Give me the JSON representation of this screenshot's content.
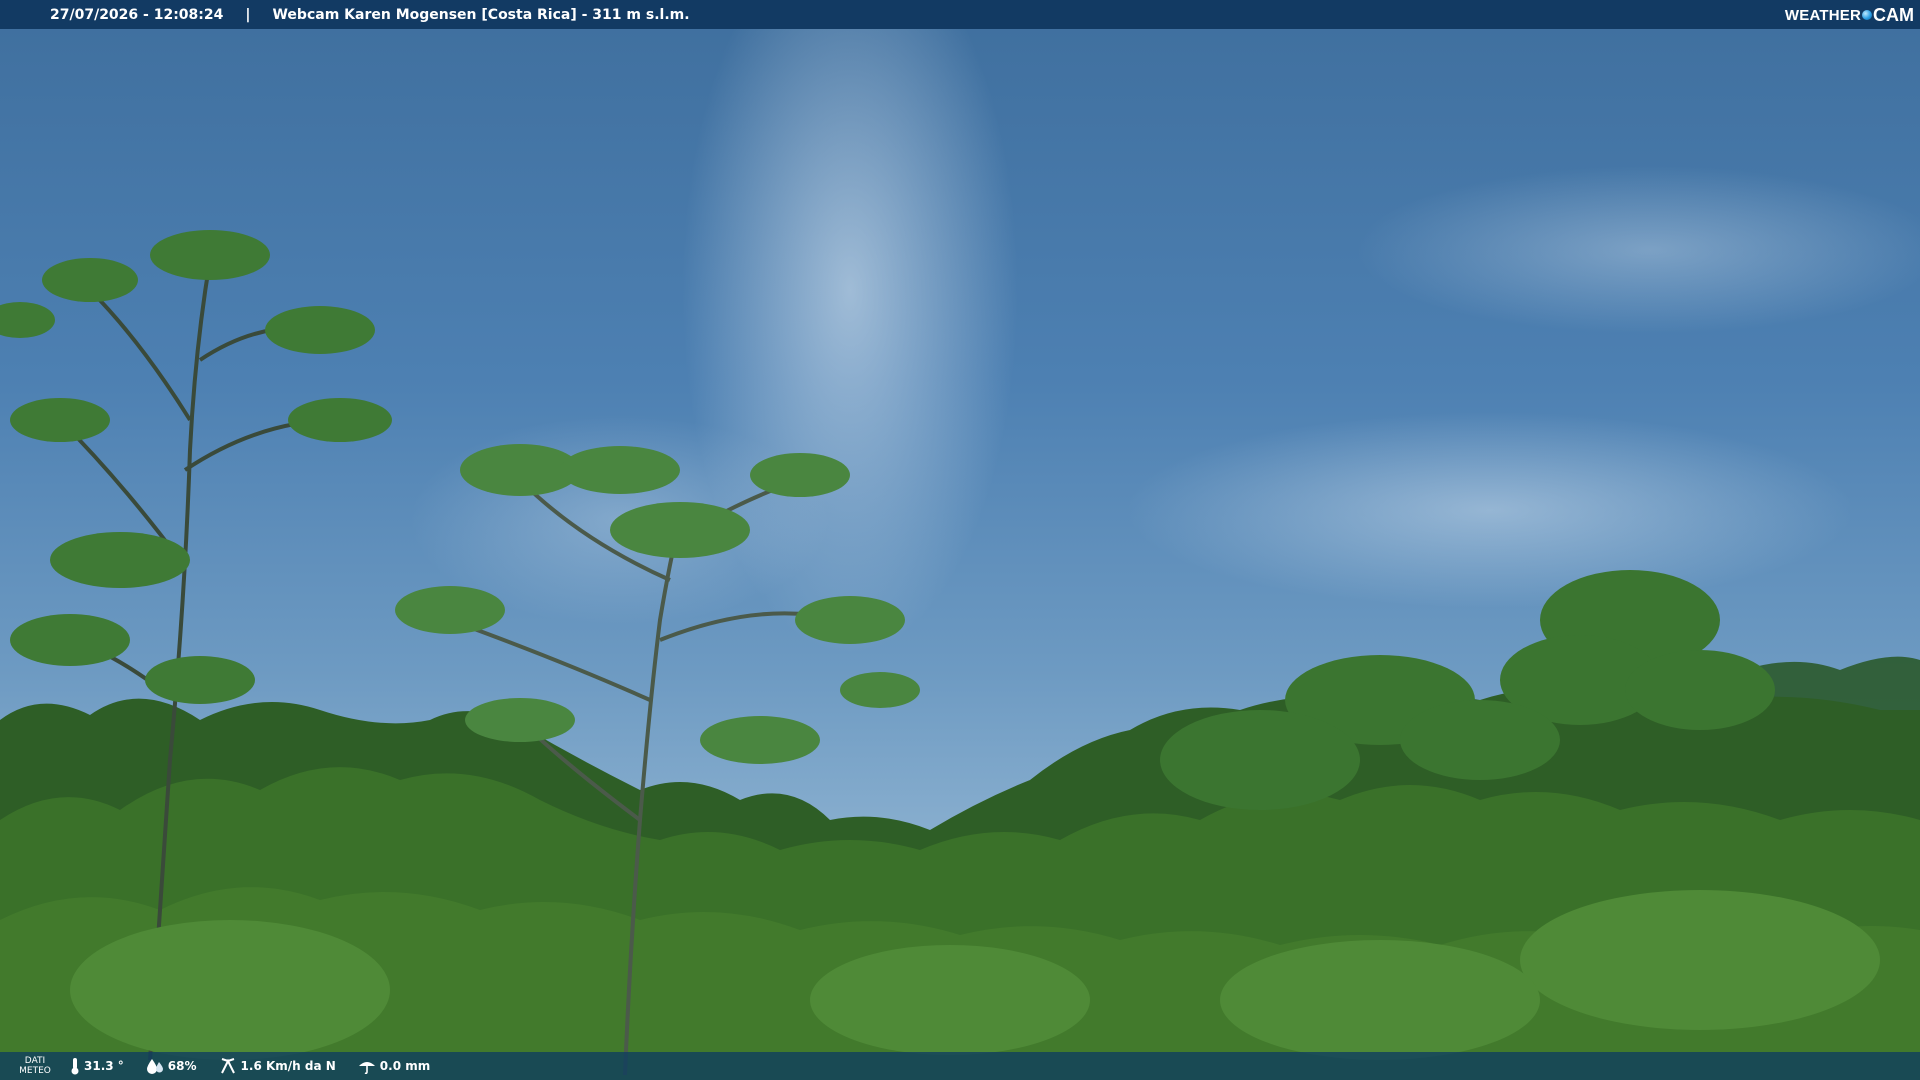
{
  "header": {
    "datetime": "27/07/2026 - 12:08:24",
    "separator": "|",
    "location": "Webcam Karen Mogensen [Costa Rica]  - 311 m s.l.m."
  },
  "logo": {
    "part1": "WEATHER",
    "part2": "CAM"
  },
  "footer": {
    "dati_line1": "DATI",
    "dati_line2": "METEO",
    "temperature": "31.3 °",
    "humidity": "68%",
    "wind": "1.6 Km/h da N",
    "rain": "0.0 mm"
  },
  "colors": {
    "topbar": "#123a63",
    "bottombar": "#0e3c60",
    "sky": "#4d80b2",
    "foliage": "#2f6a24"
  },
  "icons": {
    "temperature": "thermometer-icon",
    "humidity": "humidity-icon",
    "wind": "wind-icon",
    "rain": "rain-icon",
    "logo": "camera-lens-icon"
  }
}
